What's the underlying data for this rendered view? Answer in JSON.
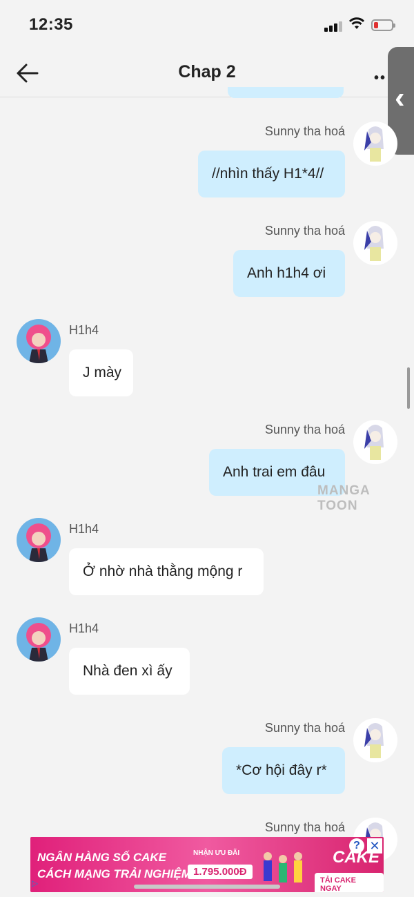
{
  "status_bar": {
    "time": "12:35"
  },
  "header": {
    "title": "Chap 2",
    "more_icon": "more-dots-icon",
    "back_icon": "back-arrow-icon"
  },
  "messages": [
    {
      "sender": "Sunny tha hoá",
      "text": "//nhìn thấy H1*4//",
      "side": "right"
    },
    {
      "sender": "Sunny tha hoá",
      "text": "Anh h1h4 ơi",
      "side": "right"
    },
    {
      "sender": "H1h4",
      "text": "J mày",
      "side": "left"
    },
    {
      "sender": "Sunny tha hoá",
      "text": "Anh trai em đâu",
      "side": "right"
    },
    {
      "sender": "H1h4",
      "text": "Ở nhờ nhà thằng mộng r",
      "side": "left"
    },
    {
      "sender": "H1h4",
      "text": "Nhà đen xì ấy",
      "side": "left"
    },
    {
      "sender": "Sunny tha hoá",
      "text": "*Cơ hội đây r*",
      "side": "right"
    },
    {
      "sender": "Sunny tha hoá",
      "side": "right"
    }
  ],
  "watermark": "MANGA TOON",
  "ad": {
    "line1": "NGÂN HÀNG SỐ CAKE",
    "line2": "CÁCH MẠNG TRẢI NGHIỆM",
    "badge": "NHẬN ƯU ĐÃI",
    "amount": "1.795.000Đ",
    "brand": "CAKE",
    "cta": "TẢI CAKE NGAY",
    "help": "?",
    "close": "✕"
  },
  "colors": {
    "my_bubble": "#cfeefe",
    "other_bubble": "#ffffff",
    "background": "#f3f3f3",
    "ad": "#e0207a"
  }
}
